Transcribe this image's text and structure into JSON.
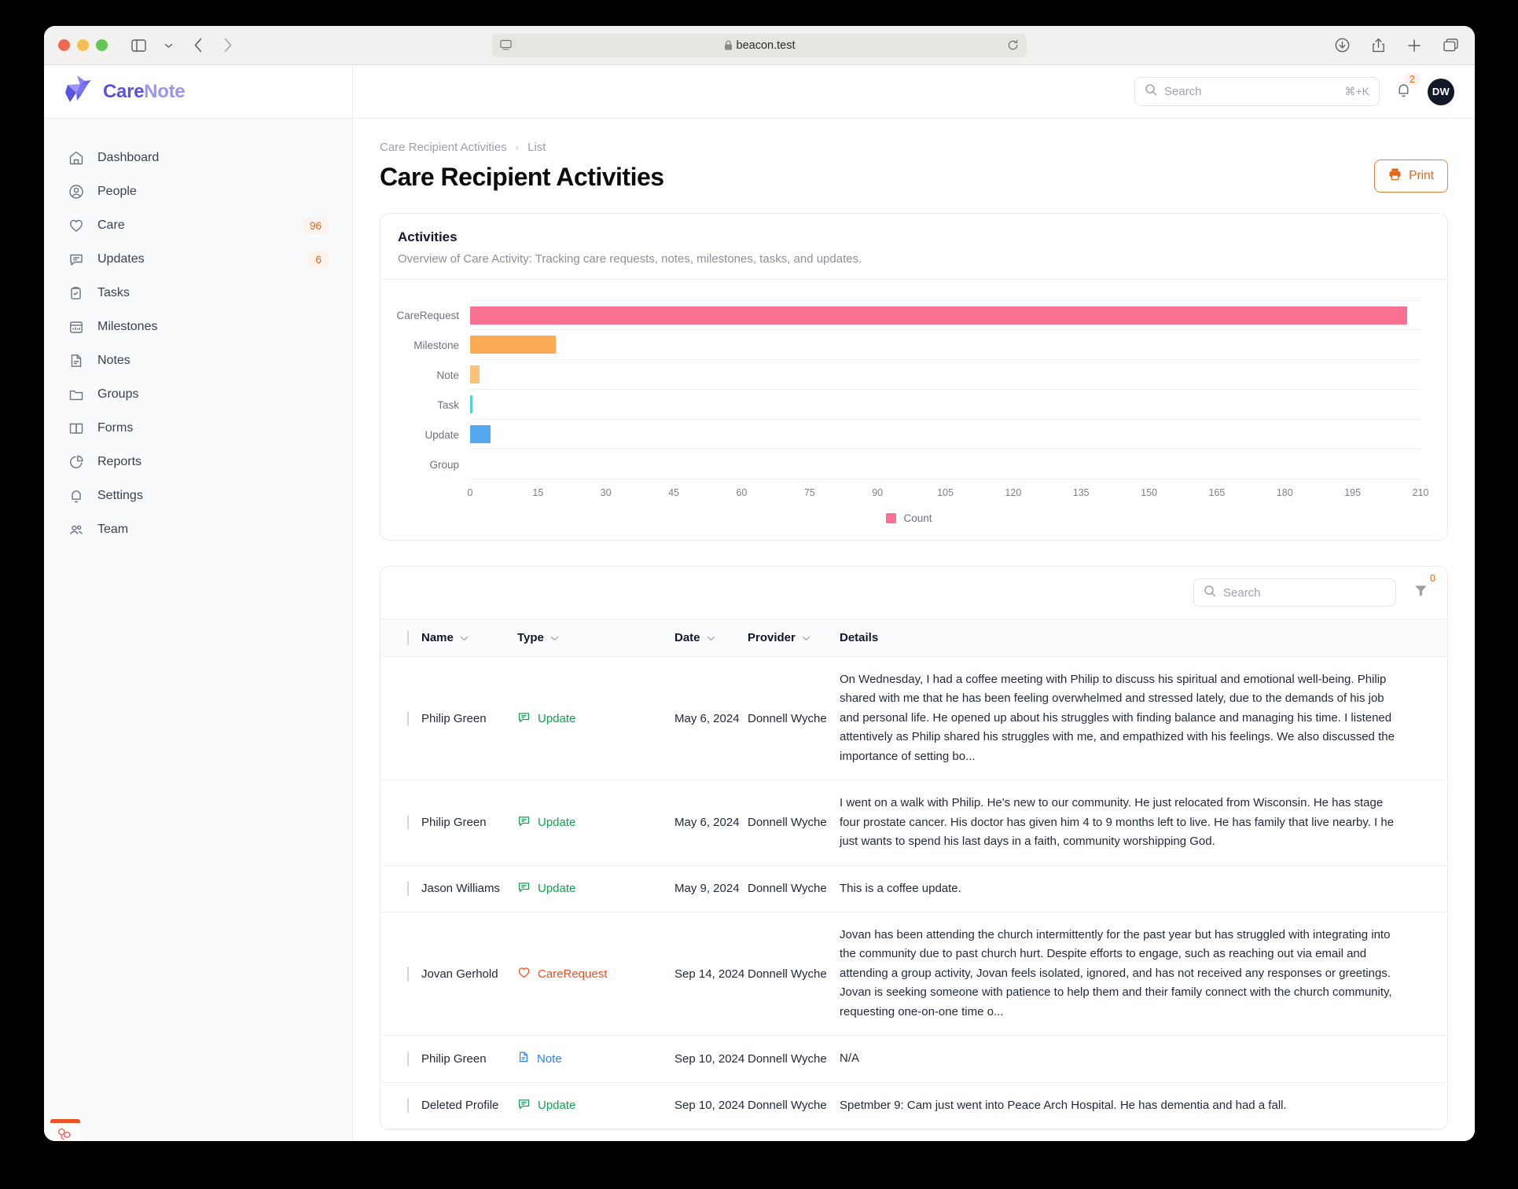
{
  "browser": {
    "url": "beacon.test",
    "lock_icon": "lock-icon",
    "sidebar_toggle_icon": "sidebar-toggle-icon",
    "back_icon": "back-arrow-icon",
    "forward_icon": "forward-arrow-icon",
    "reader_icon": "reader-view-icon",
    "reload_icon": "reload-icon",
    "download_icon": "download-icon",
    "share_icon": "share-icon",
    "new_tab_icon": "new-tab-icon",
    "tabs_icon": "tab-overview-icon"
  },
  "brand": {
    "name_first": "Care",
    "name_second": "Note",
    "logo_icon": "origami-bird-logo"
  },
  "sidebar": {
    "items": [
      {
        "label": "Dashboard",
        "icon": "home-icon",
        "badge": ""
      },
      {
        "label": "People",
        "icon": "user-icon",
        "badge": ""
      },
      {
        "label": "Care",
        "icon": "heart-icon",
        "badge": "96"
      },
      {
        "label": "Updates",
        "icon": "message-icon",
        "badge": "6"
      },
      {
        "label": "Tasks",
        "icon": "clipboard-icon",
        "badge": ""
      },
      {
        "label": "Milestones",
        "icon": "calendar-icon",
        "badge": ""
      },
      {
        "label": "Notes",
        "icon": "document-icon",
        "badge": ""
      },
      {
        "label": "Groups",
        "icon": "folder-icon",
        "badge": ""
      },
      {
        "label": "Forms",
        "icon": "book-icon",
        "badge": ""
      },
      {
        "label": "Reports",
        "icon": "pie-chart-icon",
        "badge": ""
      },
      {
        "label": "Settings",
        "icon": "bell-icon",
        "badge": ""
      },
      {
        "label": "Team",
        "icon": "users-icon",
        "badge": ""
      }
    ],
    "debug_badge_icon": "laravel-icon"
  },
  "topbar": {
    "search_placeholder": "Search",
    "search_shortcut": "⌘+K",
    "search_icon": "search-icon",
    "bell_icon": "bell-icon",
    "notification_count": "2",
    "avatar_initials": "DW"
  },
  "page": {
    "breadcrumb": [
      "Care Recipient Activities",
      "List"
    ],
    "breadcrumb_separator": "›",
    "title": "Care Recipient Activities",
    "print_label": "Print",
    "print_icon": "printer-icon"
  },
  "chart_card": {
    "title": "Activities",
    "subtitle": "Overview of Care Activity: Tracking care requests, notes, milestones, tasks, and updates."
  },
  "chart_data": {
    "type": "bar",
    "orientation": "horizontal",
    "title": "Activities",
    "categories": [
      "CareRequest",
      "Milestone",
      "Note",
      "Task",
      "Update",
      "Group"
    ],
    "values": [
      207,
      19,
      2,
      0.6,
      4.5,
      0
    ],
    "colors": [
      "#fa7090",
      "#fcaa55",
      "#fcc277",
      "#4fd1d9",
      "#56a9ef",
      "#cccccc"
    ],
    "series": [
      {
        "name": "Count",
        "values": [
          207,
          19,
          2,
          0.6,
          4.5,
          0
        ]
      }
    ],
    "xlabel": "",
    "ylabel": "",
    "xlim": [
      0,
      210
    ],
    "xticks": [
      "0",
      "15",
      "30",
      "45",
      "60",
      "75",
      "90",
      "105",
      "120",
      "135",
      "150",
      "165",
      "180",
      "195",
      "210"
    ],
    "grid": true,
    "legend": [
      {
        "label": "Count",
        "color": "#fa7090"
      }
    ],
    "legend_position": "bottom"
  },
  "table": {
    "search_placeholder": "Search",
    "search_icon": "search-icon",
    "filter_icon": "filter-icon",
    "filter_count": "0",
    "sort_icon": "chevron-down-icon",
    "columns": [
      {
        "key": "check",
        "label": ""
      },
      {
        "key": "name",
        "label": "Name",
        "sortable": true
      },
      {
        "key": "type",
        "label": "Type",
        "sortable": true
      },
      {
        "key": "date",
        "label": "Date",
        "sortable": true
      },
      {
        "key": "provider",
        "label": "Provider",
        "sortable": true
      },
      {
        "key": "details",
        "label": "Details",
        "sortable": false
      }
    ],
    "rows": [
      {
        "name": "Philip Green",
        "type": "Update",
        "type_icon": "message-icon",
        "type_color": "#12a150",
        "date": "May 6, 2024",
        "provider": "Donnell Wyche",
        "details": "On Wednesday, I had a coffee meeting with Philip to discuss his spiritual and emotional well-being. Philip shared with me that he has been feeling overwhelmed and stressed lately, due to the demands of his job and personal life. He opened up about his struggles with finding balance and managing his time. I listened attentively as Philip shared his struggles with me, and empathized with his feelings. We also discussed the importance of setting bo..."
      },
      {
        "name": "Philip Green",
        "type": "Update",
        "type_icon": "message-icon",
        "type_color": "#12a150",
        "date": "May 6, 2024",
        "provider": "Donnell Wyche",
        "details": "I went on a walk with Philip. He's new to our community. He just relocated from Wisconsin. He has stage four prostate cancer. His doctor has given him 4 to 9 months left to live. He has family that live nearby. I he just wants to spend his last days in a faith, community worshipping God."
      },
      {
        "name": "Jason Williams",
        "type": "Update",
        "type_icon": "message-icon",
        "type_color": "#12a150",
        "date": "May 9, 2024",
        "provider": "Donnell Wyche",
        "details": "This is a coffee update."
      },
      {
        "name": "Jovan Gerhold",
        "type": "CareRequest",
        "type_icon": "heart-icon",
        "type_color": "#f2501e",
        "date": "Sep 14, 2024",
        "provider": "Donnell Wyche",
        "details": "Jovan has been attending the church intermittently for the past year but has struggled with integrating into the community due to past church hurt. Despite efforts to engage, such as reaching out via email and attending a group activity, Jovan feels isolated, ignored, and has not received any responses or greetings. Jovan is seeking someone with patience to help them and their family connect with the church community, requesting one-on-one time o..."
      },
      {
        "name": "Philip Green",
        "type": "Note",
        "type_icon": "document-icon",
        "type_color": "#2a7df5",
        "date": "Sep 10, 2024",
        "provider": "Donnell Wyche",
        "details": "N/A"
      },
      {
        "name": "Deleted Profile",
        "type": "Update",
        "type_icon": "message-icon",
        "type_color": "#12a150",
        "date": "Sep 10, 2024",
        "provider": "Donnell Wyche",
        "details": "Spetmber 9: Cam just went into Peace Arch Hospital. He has dementia and had a fall."
      }
    ]
  }
}
